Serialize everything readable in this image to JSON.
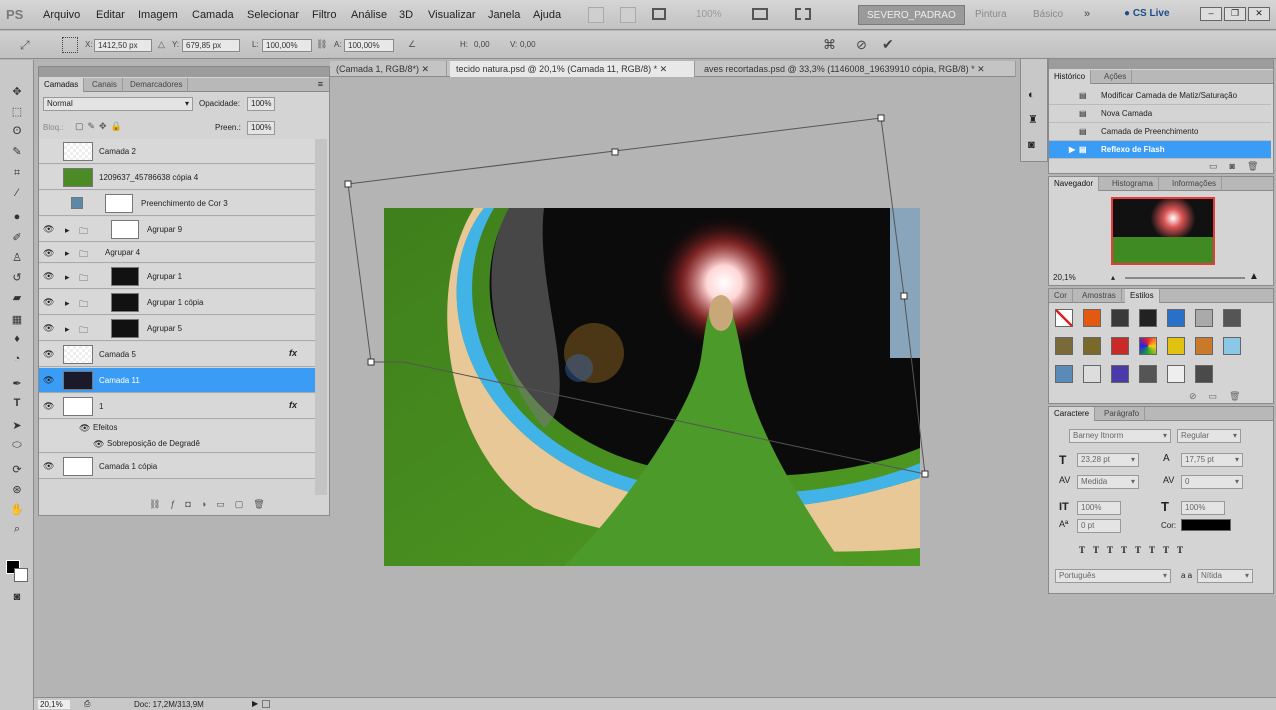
{
  "app": {
    "logo": "PS"
  },
  "menu": [
    "Arquivo",
    "Editar",
    "Imagem",
    "Camada",
    "Selecionar",
    "Filtro",
    "Análise",
    "3D",
    "Visualizar",
    "Janela",
    "Ajuda"
  ],
  "workspace": {
    "active": "SEVERO_PADRAO",
    "links": [
      "Pintura",
      "Básico"
    ],
    "cslive": "CS Live"
  },
  "zoom_menu": "100%",
  "options": {
    "x": "1412,50 px",
    "y": "679,85 px",
    "w": "100,00%",
    "h": "100,00%",
    "x_label": "X:",
    "y_label": "Y:",
    "w_label": "L:",
    "h_label": "A:",
    "h2": "H:",
    "v": "V:",
    "h2_val": "0,00",
    "v_val": "0,00"
  },
  "doc_tabs": [
    {
      "label": "(Camada 1, RGB/8*)",
      "active": false
    },
    {
      "label": "tecido natura.psd @ 20,1% (Camada 11, RGB/8) *",
      "active": true
    },
    {
      "label": "aves recortadas.psd @ 33,3% (1146008_19639910 cópia, RGB/8) *",
      "active": false
    }
  ],
  "layers_panel": {
    "tabs": [
      "Camadas",
      "Canais",
      "Demarcadores"
    ],
    "blend": "Normal",
    "opacity_label": "Opacidade:",
    "opacity": "100%",
    "lock_label": "Bloq.:",
    "fill_label": "Preen.:",
    "fill": "100%",
    "layers": [
      {
        "name": "Camada 2",
        "eye": false,
        "thumb": "checker"
      },
      {
        "name": "1209637_45786638 cópia 4",
        "eye": false,
        "thumb": "grass"
      },
      {
        "name": "Preenchimento de Cor 3",
        "eye": false,
        "thumb": "fill"
      },
      {
        "name": "Agrupar 9",
        "eye": true,
        "thumb": "folder"
      },
      {
        "name": "Agrupar 4",
        "eye": true,
        "thumb": "folder"
      },
      {
        "name": "Agrupar 1",
        "eye": true,
        "thumb": "folder"
      },
      {
        "name": "Agrupar 1 cópia",
        "eye": true,
        "thumb": "folder"
      },
      {
        "name": "Agrupar 5",
        "eye": true,
        "thumb": "folder"
      },
      {
        "name": "Camada 5",
        "eye": true,
        "thumb": "checker"
      },
      {
        "name": "Camada 11",
        "eye": true,
        "thumb": "dark",
        "selected": true
      },
      {
        "name": "1",
        "eye": true,
        "thumb": "white"
      },
      {
        "name": "Efeitos",
        "eye": true,
        "thumb": "none"
      },
      {
        "name": "Sobreposição de Degradê",
        "eye": true,
        "thumb": "none"
      },
      {
        "name": "Camada 1 cópia",
        "eye": true,
        "thumb": "figure"
      }
    ]
  },
  "history": {
    "tabs": [
      "Histórico",
      "Ações"
    ],
    "items": [
      "Modificar Camada de Matiz/Saturação",
      "Nova Camada",
      "Camada de Preenchimento",
      "Reflexo de Flash"
    ]
  },
  "navigator": {
    "tabs": [
      "Navegador",
      "Histograma",
      "Informações"
    ],
    "zoom": "20,1%"
  },
  "color_panel": {
    "tabs": [
      "Cor",
      "Amostras",
      "Estilos"
    ]
  },
  "character": {
    "tabs": [
      "Caractere",
      "Parágrafo"
    ],
    "font": "Barney Itnorm",
    "style": "Regular",
    "size": "23,28 pt",
    "leading": "17,75 pt",
    "kerning": "Medida",
    "tracking": "0",
    "vscale": "100%",
    "hscale": "100%",
    "baseline": "0 pt",
    "color_label": "Cor:",
    "language": "Português",
    "aa": "Nítida",
    "aa_label": "a a"
  },
  "status": {
    "zoom": "20,1%",
    "doc": "Doc: 17,2M/313,9M"
  },
  "colors": {
    "accent": "#3b9cf5",
    "panel": "#d4d4d4",
    "bg": "#b4b4b4"
  }
}
